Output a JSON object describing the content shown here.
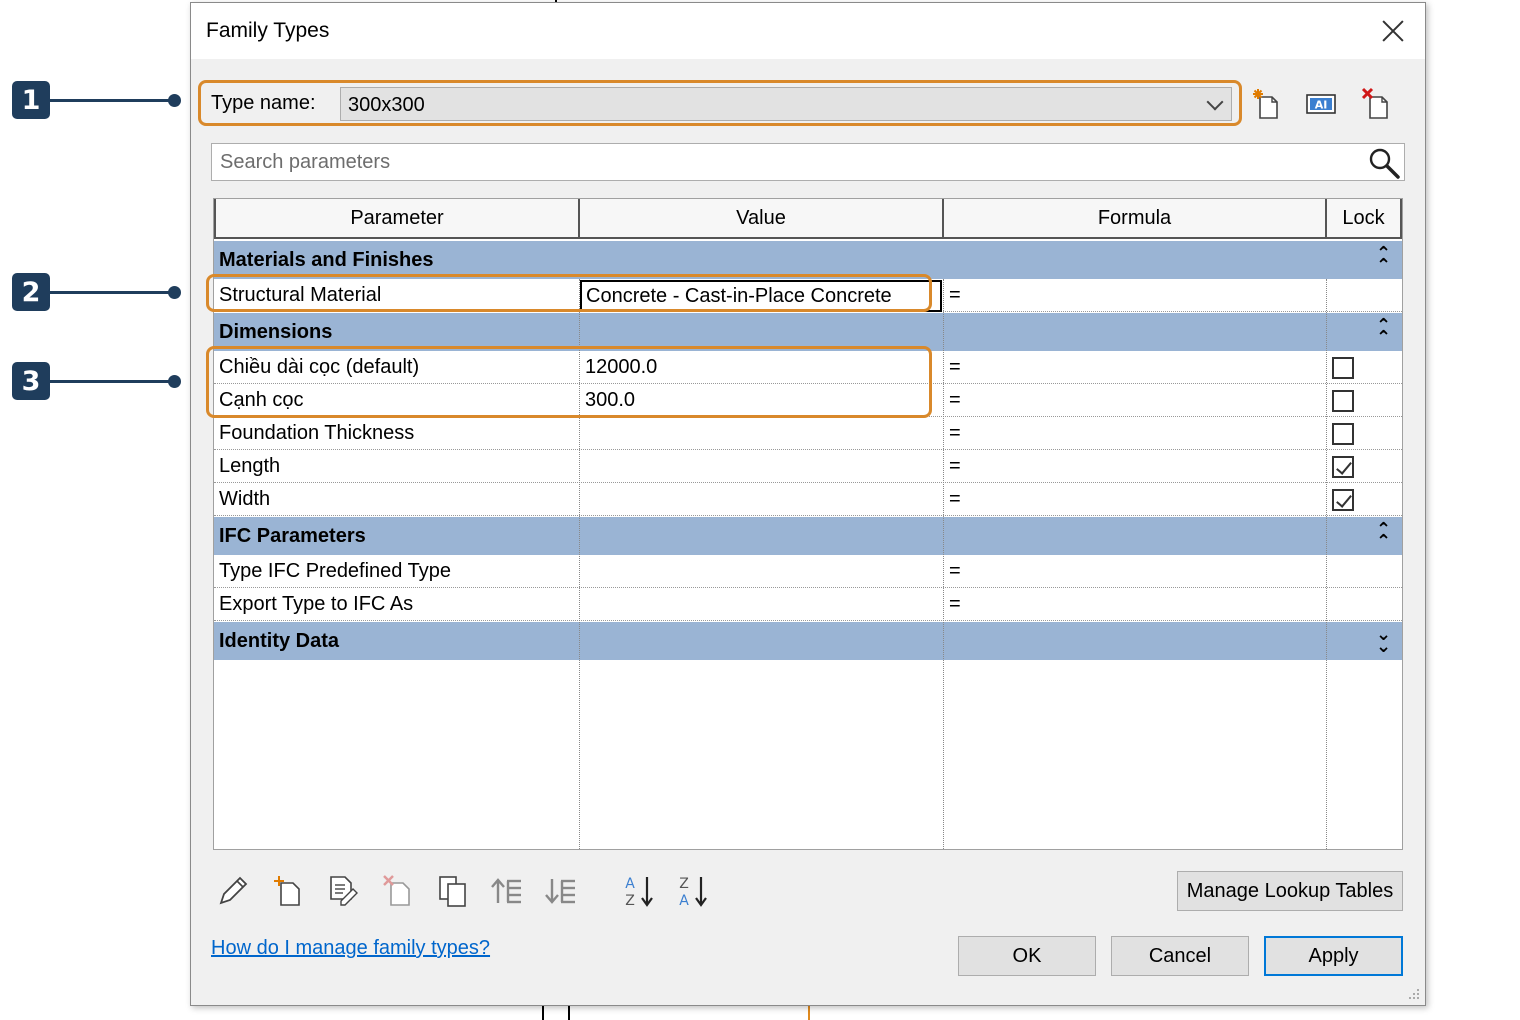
{
  "callouts": [
    "1",
    "2",
    "3"
  ],
  "dialog": {
    "title": "Family Types",
    "close_icon": "close-icon",
    "type_name_label": "Type name:",
    "type_name_value": "300x300",
    "toolbar_icons": [
      "new-type-icon",
      "rename-type-icon",
      "delete-type-icon"
    ],
    "search_placeholder": "Search parameters"
  },
  "grid": {
    "columns": [
      "Parameter",
      "Value",
      "Formula",
      "Lock"
    ],
    "groups": [
      {
        "name": "Materials and Finishes",
        "toggle": "⌃",
        "rows": [
          {
            "parameter": "Structural Material",
            "value": "Concrete - Cast-in-Place Concrete",
            "formula": "=",
            "lock": null
          }
        ]
      },
      {
        "name": "Dimensions",
        "toggle": "⌃",
        "rows": [
          {
            "parameter": "Chiều dài cọc (default)",
            "value": "12000.0",
            "formula": "=",
            "lock": false
          },
          {
            "parameter": "Cạnh cọc",
            "value": "300.0",
            "formula": "=",
            "lock": false
          },
          {
            "parameter": "Foundation Thickness",
            "value": "",
            "formula": "=",
            "lock": false
          },
          {
            "parameter": "Length",
            "value": "",
            "formula": "=",
            "lock": true
          },
          {
            "parameter": "Width",
            "value": "",
            "formula": "=",
            "lock": true
          }
        ]
      },
      {
        "name": "IFC Parameters",
        "toggle": "⌃",
        "rows": [
          {
            "parameter": "Type IFC Predefined Type",
            "value": "",
            "formula": "=",
            "lock": null
          },
          {
            "parameter": "Export Type to IFC As",
            "value": "",
            "formula": "=",
            "lock": null
          }
        ]
      },
      {
        "name": "Identity Data",
        "toggle": "⌄",
        "rows": []
      }
    ]
  },
  "bottom_toolbar_icons": [
    "edit-parameter-icon",
    "new-parameter-icon",
    "parameter-properties-icon",
    "delete-parameter-icon",
    "copy-parameter-icon",
    "move-up-icon",
    "move-down-icon",
    "sort-ascending-icon",
    "sort-descending-icon"
  ],
  "buttons": {
    "manage_lookup": "Manage Lookup Tables",
    "ok": "OK",
    "cancel": "Cancel",
    "apply": "Apply"
  },
  "help_link": "How do I manage family types?",
  "colors": {
    "highlight": "#d9892b",
    "callout": "#1f3d5c",
    "group_header": "#9ab4d4",
    "link": "#0066cc"
  }
}
